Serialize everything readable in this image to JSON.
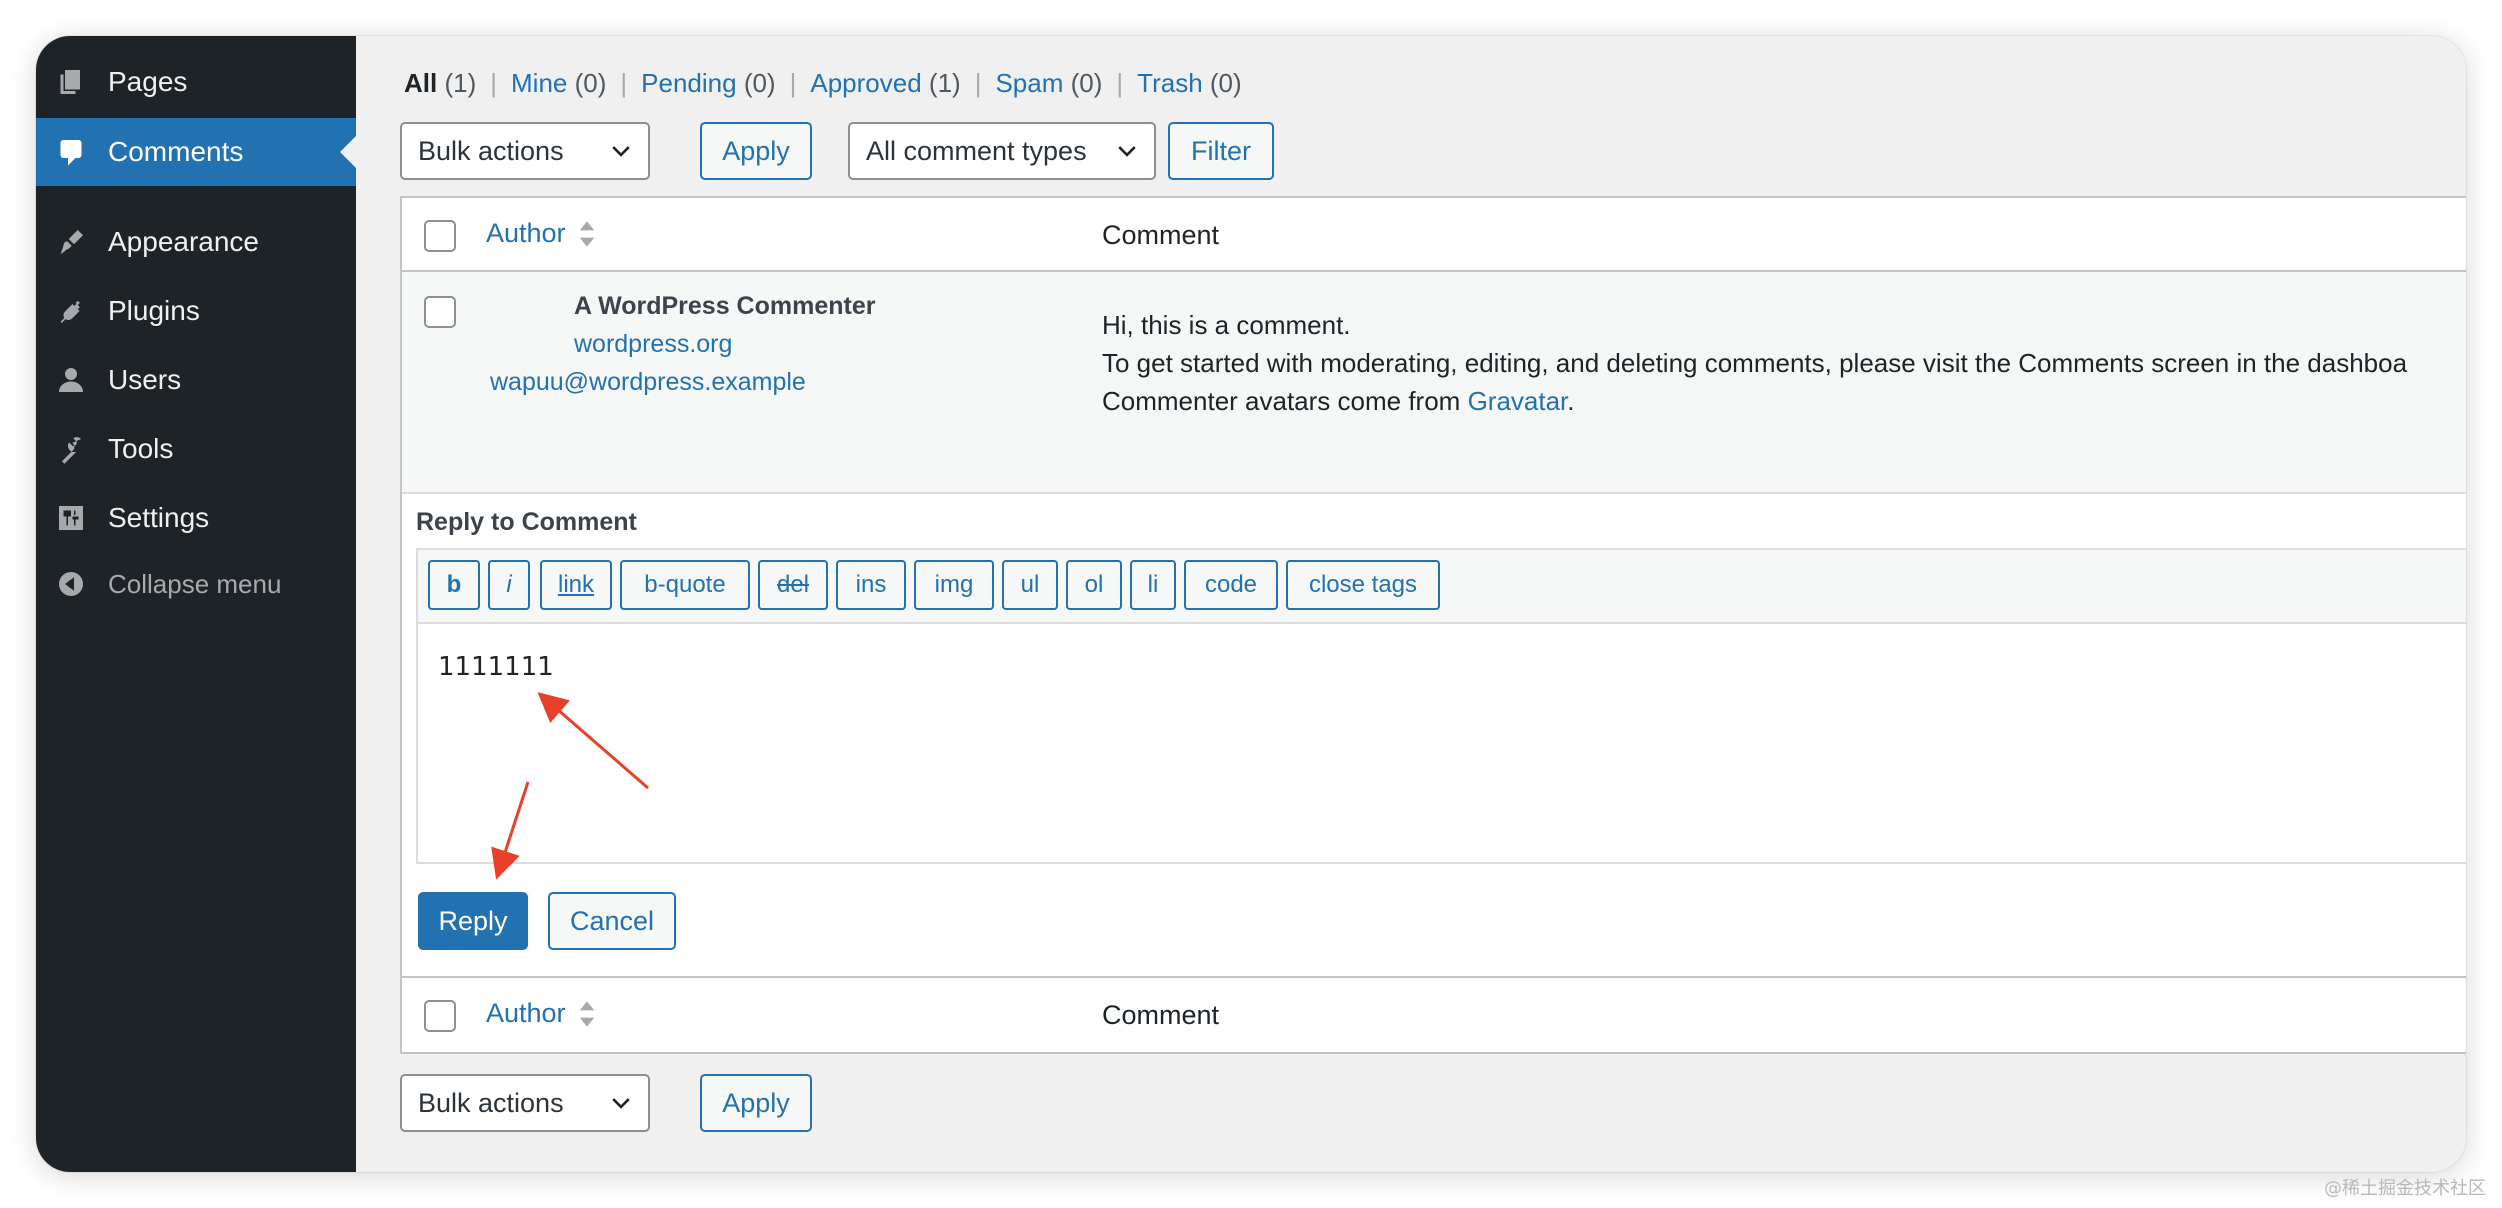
{
  "sidebar": {
    "items": [
      {
        "label": "Pages",
        "icon": "pages-icon"
      },
      {
        "label": "Comments",
        "icon": "comments-icon",
        "current": true
      },
      {
        "label": "Appearance",
        "icon": "appearance-icon"
      },
      {
        "label": "Plugins",
        "icon": "plugins-icon"
      },
      {
        "label": "Users",
        "icon": "users-icon"
      },
      {
        "label": "Tools",
        "icon": "tools-icon"
      },
      {
        "label": "Settings",
        "icon": "settings-icon"
      }
    ],
    "collapse_label": "Collapse menu"
  },
  "filters": {
    "all": {
      "label": "All",
      "count": "(1)"
    },
    "mine": {
      "label": "Mine",
      "count": "(0)"
    },
    "pending": {
      "label": "Pending",
      "count": "(0)"
    },
    "approved": {
      "label": "Approved",
      "count": "(1)"
    },
    "spam": {
      "label": "Spam",
      "count": "(0)"
    },
    "trash": {
      "label": "Trash",
      "count": "(0)"
    },
    "separator": "|"
  },
  "toolbar": {
    "bulk_actions": "Bulk actions",
    "apply": "Apply",
    "comment_types": "All comment types",
    "filter": "Filter"
  },
  "table": {
    "col_author": "Author",
    "col_comment": "Comment"
  },
  "comment": {
    "author_name": "A WordPress Commenter",
    "author_url": "wordpress.org",
    "author_email": "wapuu@wordpress.example",
    "line1": "Hi, this is a comment.",
    "line2": "To get started with moderating, editing, and deleting comments, please visit the Comments screen in the dashboa",
    "line3_prefix": "Commenter avatars come from ",
    "line3_link": "Gravatar",
    "line3_suffix": "."
  },
  "reply": {
    "title": "Reply to Comment",
    "quicktags": [
      "b",
      "i",
      "link",
      "b-quote",
      "del",
      "ins",
      "img",
      "ul",
      "ol",
      "li",
      "code",
      "close tags"
    ],
    "text": "1111111",
    "reply_button": "Reply",
    "cancel_button": "Cancel"
  },
  "footer_toolbar": {
    "bulk_actions": "Bulk actions",
    "apply": "Apply"
  },
  "watermark": "@稀土掘金技术社区",
  "colors": {
    "sidebar_bg": "#1d2327",
    "accent": "#2271b1",
    "annotation_arrow": "#e8402a"
  }
}
